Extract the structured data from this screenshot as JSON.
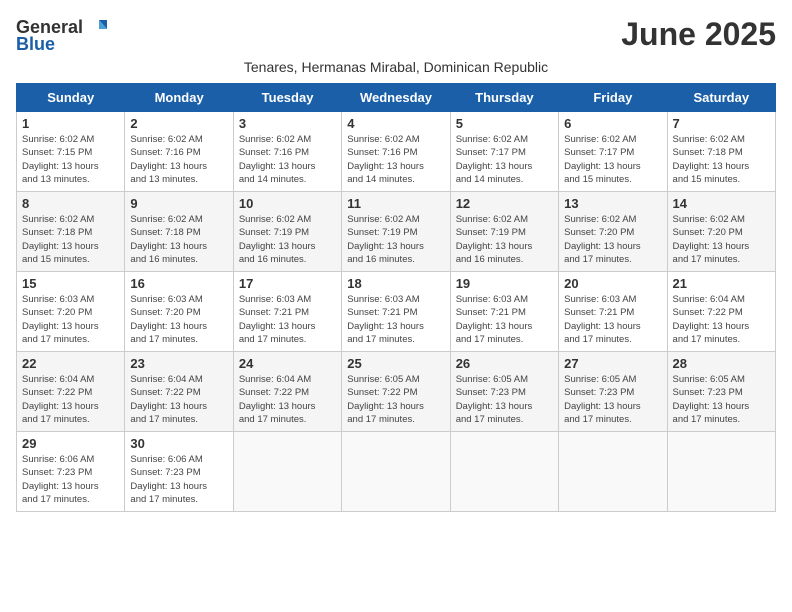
{
  "logo": {
    "general": "General",
    "blue": "Blue"
  },
  "title": "June 2025",
  "subtitle": "Tenares, Hermanas Mirabal, Dominican Republic",
  "days_of_week": [
    "Sunday",
    "Monday",
    "Tuesday",
    "Wednesday",
    "Thursday",
    "Friday",
    "Saturday"
  ],
  "weeks": [
    [
      {
        "day": "1",
        "detail": "Sunrise: 6:02 AM\nSunset: 7:15 PM\nDaylight: 13 hours\nand 13 minutes."
      },
      {
        "day": "2",
        "detail": "Sunrise: 6:02 AM\nSunset: 7:16 PM\nDaylight: 13 hours\nand 13 minutes."
      },
      {
        "day": "3",
        "detail": "Sunrise: 6:02 AM\nSunset: 7:16 PM\nDaylight: 13 hours\nand 14 minutes."
      },
      {
        "day": "4",
        "detail": "Sunrise: 6:02 AM\nSunset: 7:16 PM\nDaylight: 13 hours\nand 14 minutes."
      },
      {
        "day": "5",
        "detail": "Sunrise: 6:02 AM\nSunset: 7:17 PM\nDaylight: 13 hours\nand 14 minutes."
      },
      {
        "day": "6",
        "detail": "Sunrise: 6:02 AM\nSunset: 7:17 PM\nDaylight: 13 hours\nand 15 minutes."
      },
      {
        "day": "7",
        "detail": "Sunrise: 6:02 AM\nSunset: 7:18 PM\nDaylight: 13 hours\nand 15 minutes."
      }
    ],
    [
      {
        "day": "8",
        "detail": "Sunrise: 6:02 AM\nSunset: 7:18 PM\nDaylight: 13 hours\nand 15 minutes."
      },
      {
        "day": "9",
        "detail": "Sunrise: 6:02 AM\nSunset: 7:18 PM\nDaylight: 13 hours\nand 16 minutes."
      },
      {
        "day": "10",
        "detail": "Sunrise: 6:02 AM\nSunset: 7:19 PM\nDaylight: 13 hours\nand 16 minutes."
      },
      {
        "day": "11",
        "detail": "Sunrise: 6:02 AM\nSunset: 7:19 PM\nDaylight: 13 hours\nand 16 minutes."
      },
      {
        "day": "12",
        "detail": "Sunrise: 6:02 AM\nSunset: 7:19 PM\nDaylight: 13 hours\nand 16 minutes."
      },
      {
        "day": "13",
        "detail": "Sunrise: 6:02 AM\nSunset: 7:20 PM\nDaylight: 13 hours\nand 17 minutes."
      },
      {
        "day": "14",
        "detail": "Sunrise: 6:02 AM\nSunset: 7:20 PM\nDaylight: 13 hours\nand 17 minutes."
      }
    ],
    [
      {
        "day": "15",
        "detail": "Sunrise: 6:03 AM\nSunset: 7:20 PM\nDaylight: 13 hours\nand 17 minutes."
      },
      {
        "day": "16",
        "detail": "Sunrise: 6:03 AM\nSunset: 7:20 PM\nDaylight: 13 hours\nand 17 minutes."
      },
      {
        "day": "17",
        "detail": "Sunrise: 6:03 AM\nSunset: 7:21 PM\nDaylight: 13 hours\nand 17 minutes."
      },
      {
        "day": "18",
        "detail": "Sunrise: 6:03 AM\nSunset: 7:21 PM\nDaylight: 13 hours\nand 17 minutes."
      },
      {
        "day": "19",
        "detail": "Sunrise: 6:03 AM\nSunset: 7:21 PM\nDaylight: 13 hours\nand 17 minutes."
      },
      {
        "day": "20",
        "detail": "Sunrise: 6:03 AM\nSunset: 7:21 PM\nDaylight: 13 hours\nand 17 minutes."
      },
      {
        "day": "21",
        "detail": "Sunrise: 6:04 AM\nSunset: 7:22 PM\nDaylight: 13 hours\nand 17 minutes."
      }
    ],
    [
      {
        "day": "22",
        "detail": "Sunrise: 6:04 AM\nSunset: 7:22 PM\nDaylight: 13 hours\nand 17 minutes."
      },
      {
        "day": "23",
        "detail": "Sunrise: 6:04 AM\nSunset: 7:22 PM\nDaylight: 13 hours\nand 17 minutes."
      },
      {
        "day": "24",
        "detail": "Sunrise: 6:04 AM\nSunset: 7:22 PM\nDaylight: 13 hours\nand 17 minutes."
      },
      {
        "day": "25",
        "detail": "Sunrise: 6:05 AM\nSunset: 7:22 PM\nDaylight: 13 hours\nand 17 minutes."
      },
      {
        "day": "26",
        "detail": "Sunrise: 6:05 AM\nSunset: 7:23 PM\nDaylight: 13 hours\nand 17 minutes."
      },
      {
        "day": "27",
        "detail": "Sunrise: 6:05 AM\nSunset: 7:23 PM\nDaylight: 13 hours\nand 17 minutes."
      },
      {
        "day": "28",
        "detail": "Sunrise: 6:05 AM\nSunset: 7:23 PM\nDaylight: 13 hours\nand 17 minutes."
      }
    ],
    [
      {
        "day": "29",
        "detail": "Sunrise: 6:06 AM\nSunset: 7:23 PM\nDaylight: 13 hours\nand 17 minutes."
      },
      {
        "day": "30",
        "detail": "Sunrise: 6:06 AM\nSunset: 7:23 PM\nDaylight: 13 hours\nand 17 minutes."
      },
      {
        "day": "",
        "detail": ""
      },
      {
        "day": "",
        "detail": ""
      },
      {
        "day": "",
        "detail": ""
      },
      {
        "day": "",
        "detail": ""
      },
      {
        "day": "",
        "detail": ""
      }
    ]
  ]
}
